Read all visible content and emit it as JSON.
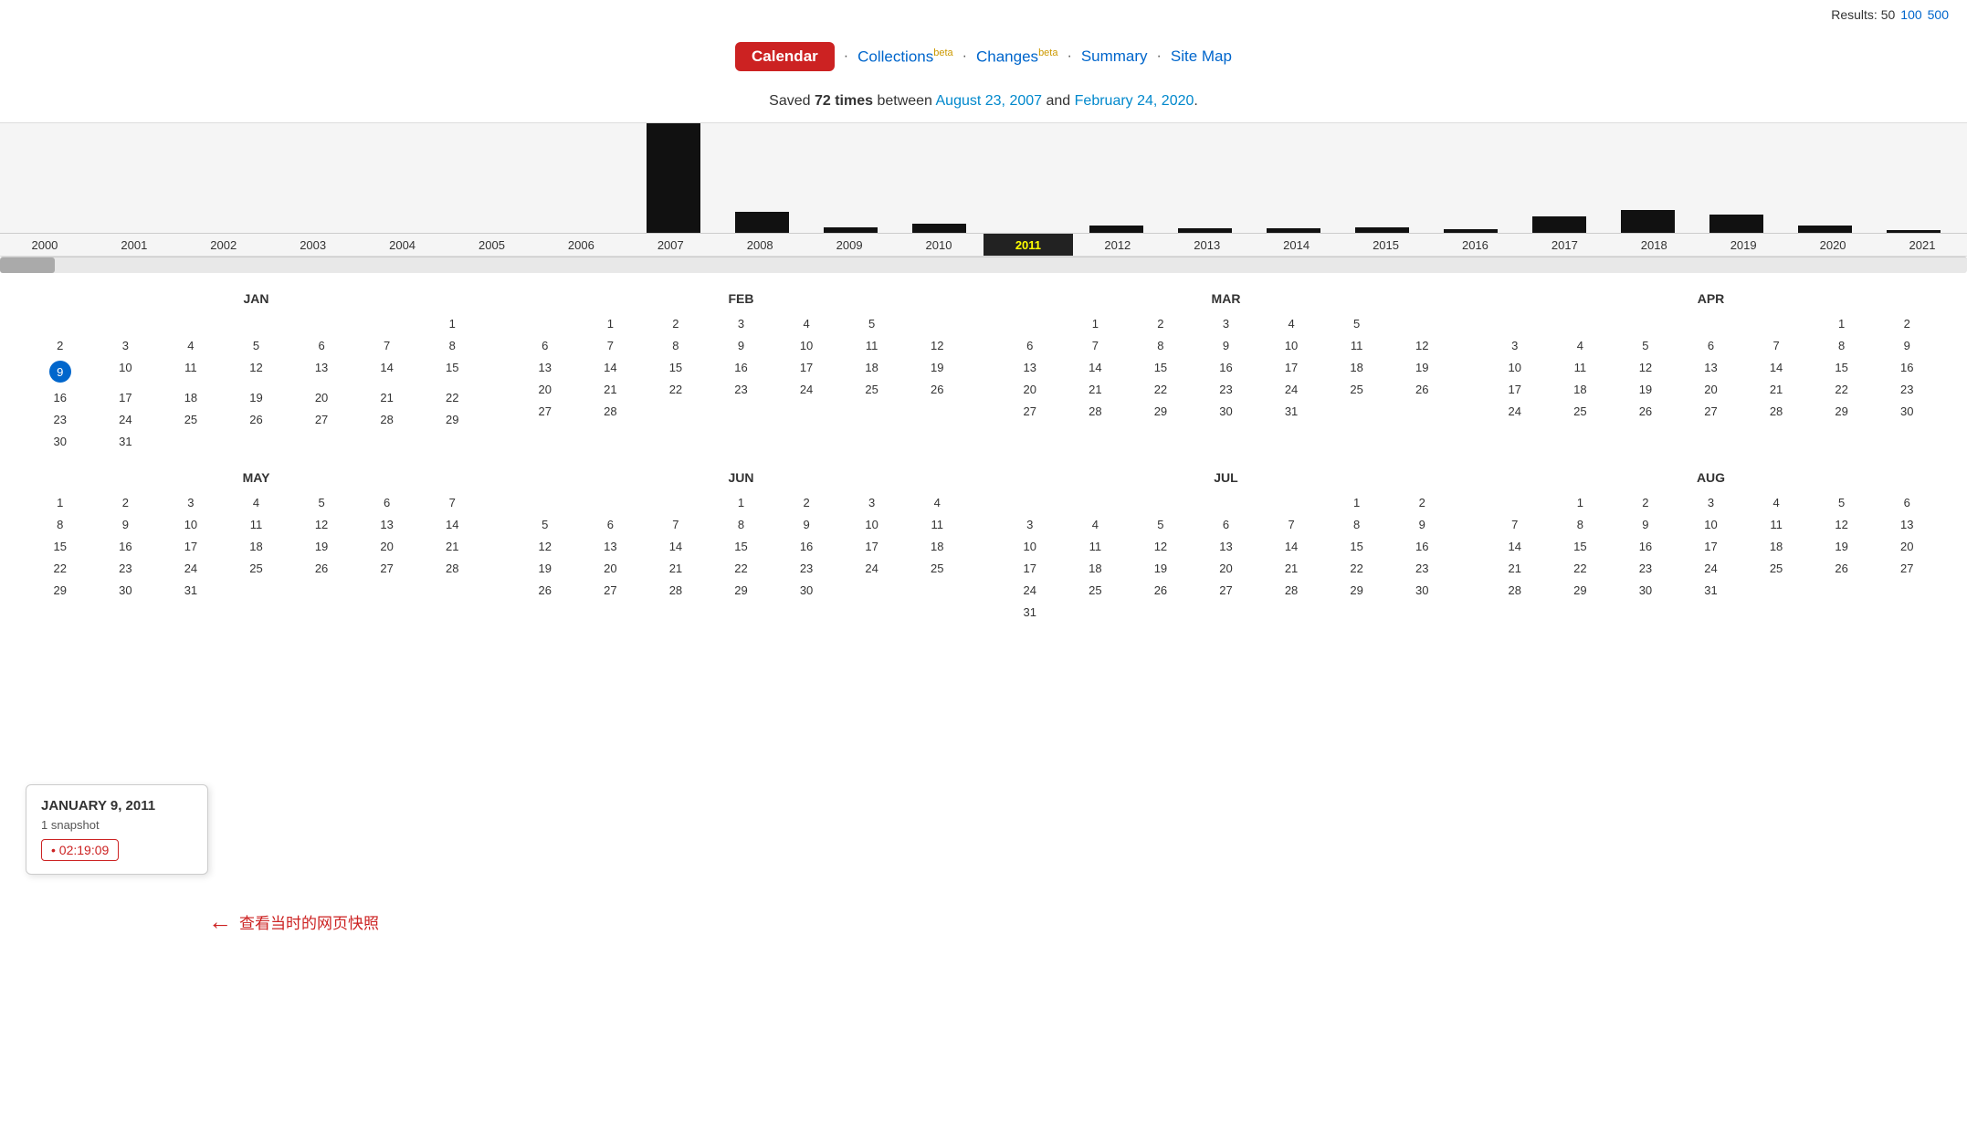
{
  "topbar": {
    "results_label": "Results: 50",
    "results_100": "100",
    "results_500": "500"
  },
  "nav": {
    "calendar_label": "Calendar",
    "collections_label": "Collections",
    "collections_beta": "beta",
    "changes_label": "Changes",
    "changes_beta": "beta",
    "summary_label": "Summary",
    "sitemap_label": "Site Map"
  },
  "saved": {
    "prefix": "Saved ",
    "times": "72 times",
    "between": " between ",
    "start_date": "August 23, 2007",
    "and": " and ",
    "end_date": "February 24, 2020",
    "period": "."
  },
  "timeline": {
    "years": [
      "2000",
      "2001",
      "2002",
      "2003",
      "2004",
      "2005",
      "2006",
      "2007",
      "2008",
      "2009",
      "2010",
      "2011",
      "2012",
      "2013",
      "2014",
      "2015",
      "2016",
      "2017",
      "2018",
      "2019",
      "2020",
      "2021"
    ],
    "selected_year": "2011",
    "bars": [
      0,
      0,
      0,
      0,
      0,
      0,
      0,
      95,
      18,
      5,
      8,
      0,
      6,
      4,
      4,
      5,
      3,
      14,
      20,
      16,
      6,
      2
    ]
  },
  "calendar": {
    "year": "2011",
    "months": [
      {
        "name": "JAN",
        "weeks": [
          [
            null,
            null,
            null,
            null,
            null,
            null,
            1
          ],
          [
            2,
            3,
            4,
            5,
            6,
            7,
            8
          ],
          [
            "9s",
            10,
            11,
            12,
            13,
            14,
            15
          ],
          [
            16,
            17,
            18,
            19,
            20,
            21,
            22
          ],
          [
            23,
            24,
            25,
            26,
            27,
            28,
            29
          ],
          [
            30,
            31,
            null,
            null,
            null,
            null,
            null
          ]
        ]
      },
      {
        "name": "FEB",
        "weeks": [
          [
            null,
            1,
            2,
            3,
            4,
            5,
            null
          ],
          [
            6,
            7,
            8,
            9,
            10,
            11,
            12
          ],
          [
            13,
            14,
            15,
            16,
            17,
            18,
            19
          ],
          [
            20,
            21,
            22,
            23,
            24,
            25,
            26
          ],
          [
            27,
            28,
            null,
            null,
            null,
            null,
            null
          ]
        ]
      },
      {
        "name": "MAR",
        "weeks": [
          [
            null,
            1,
            2,
            3,
            4,
            5,
            null
          ],
          [
            6,
            7,
            8,
            9,
            10,
            11,
            12
          ],
          [
            13,
            14,
            15,
            16,
            17,
            18,
            19
          ],
          [
            20,
            21,
            22,
            23,
            24,
            25,
            26
          ],
          [
            27,
            28,
            29,
            30,
            31,
            null,
            null
          ]
        ]
      },
      {
        "name": "APR",
        "weeks": [
          [
            null,
            null,
            null,
            null,
            null,
            1,
            2
          ],
          [
            3,
            4,
            5,
            6,
            7,
            8,
            9
          ],
          [
            10,
            11,
            12,
            13,
            14,
            15,
            16
          ],
          [
            17,
            18,
            19,
            20,
            21,
            22,
            23
          ],
          [
            24,
            25,
            26,
            27,
            28,
            29,
            30
          ]
        ]
      },
      {
        "name": "MAY",
        "weeks": [
          [
            1,
            2,
            3,
            4,
            5,
            6,
            7
          ],
          [
            8,
            9,
            10,
            11,
            12,
            13,
            14
          ],
          [
            15,
            16,
            17,
            18,
            19,
            20,
            21
          ],
          [
            22,
            23,
            24,
            25,
            26,
            27,
            28
          ],
          [
            29,
            30,
            31,
            null,
            null,
            null,
            null
          ]
        ]
      },
      {
        "name": "JUN",
        "weeks": [
          [
            null,
            null,
            null,
            1,
            2,
            3,
            4
          ],
          [
            5,
            6,
            7,
            8,
            9,
            10,
            11
          ],
          [
            12,
            13,
            14,
            15,
            16,
            17,
            18
          ],
          [
            19,
            20,
            21,
            22,
            23,
            24,
            25
          ],
          [
            26,
            27,
            28,
            29,
            30,
            null,
            null
          ]
        ]
      },
      {
        "name": "JUL",
        "weeks": [
          [
            null,
            null,
            null,
            null,
            null,
            1,
            2
          ],
          [
            3,
            4,
            5,
            6,
            7,
            8,
            9
          ],
          [
            10,
            11,
            12,
            13,
            14,
            15,
            16
          ],
          [
            17,
            18,
            19,
            20,
            21,
            22,
            23
          ],
          [
            24,
            25,
            26,
            27,
            28,
            29,
            30
          ],
          [
            31,
            null,
            null,
            null,
            null,
            null,
            null
          ]
        ]
      },
      {
        "name": "AUG",
        "weeks": [
          [
            null,
            1,
            2,
            3,
            4,
            5,
            6
          ],
          [
            7,
            8,
            9,
            10,
            11,
            12,
            13
          ],
          [
            14,
            15,
            16,
            17,
            18,
            19,
            20
          ],
          [
            21,
            22,
            23,
            24,
            25,
            26,
            27
          ],
          [
            28,
            29,
            30,
            31,
            null,
            null,
            null
          ]
        ]
      }
    ]
  },
  "tooltip": {
    "date": "JANUARY 9, 2011",
    "count": "1 snapshot",
    "time": "02:19:09"
  },
  "annotation": {
    "text": "查看当时的网页快照"
  }
}
